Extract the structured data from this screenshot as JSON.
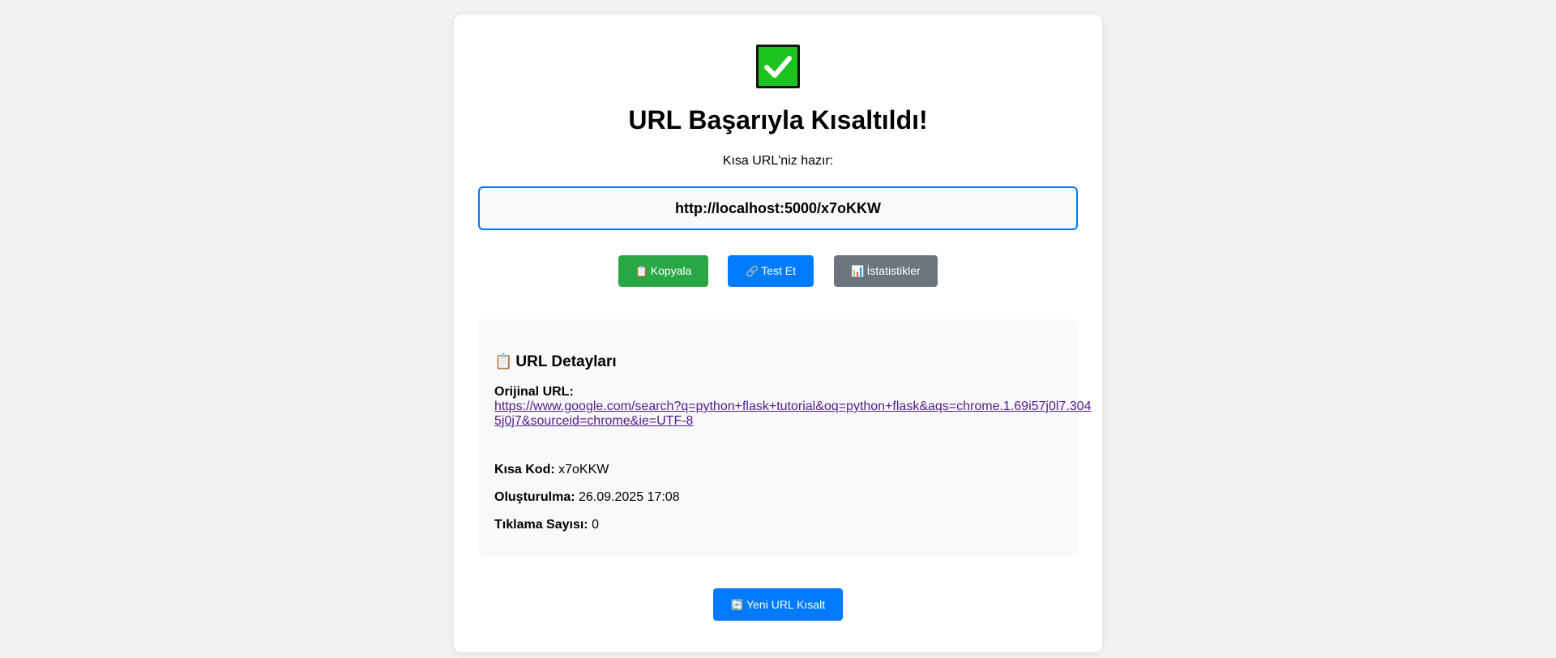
{
  "header": {
    "title": "URL Başarıyla Kısaltıldı!",
    "subtitle": "Kısa URL'niz hazır:",
    "success_icon": "check-mark-icon",
    "success_color": "#1ec21e"
  },
  "short_url": {
    "value": "http://localhost:5000/x7oKKW",
    "border_color": "#007bff"
  },
  "actions": {
    "copy": {
      "icon": "📋",
      "label": "Kopyala",
      "color": "#28a745"
    },
    "test": {
      "icon": "🔗",
      "label": "Test Et",
      "color": "#007bff"
    },
    "stats": {
      "icon": "📊",
      "label": "İstatistikler",
      "color": "#6c757d"
    }
  },
  "details": {
    "icon": "📋",
    "title": "URL Detayları",
    "original_label": "Orijinal URL:",
    "original_url": "https://www.google.com/search?q=python+flask+tutorial&oq=python+flask&aqs=chrome.1.69i57j0l7.3045j0j7&sourceid=chrome&ie=UTF-8",
    "code_label": "Kısa Kod:",
    "code_value": "x7oKKW",
    "created_label": "Oluşturulma:",
    "created_value": "26.09.2025 17:08",
    "clicks_label": "Tıklama Sayısı:",
    "clicks_value": "0"
  },
  "new_url": {
    "icon": "🔄",
    "label": "Yeni URL Kısalt",
    "color": "#007bff"
  }
}
